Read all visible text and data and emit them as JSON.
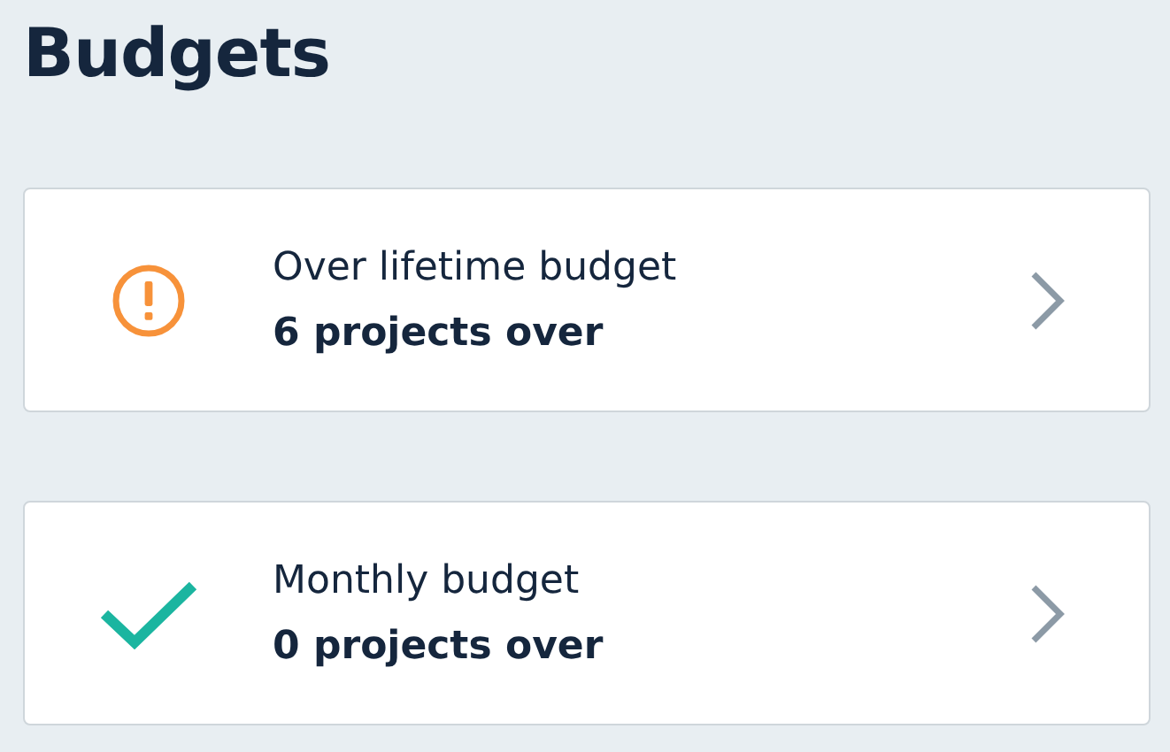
{
  "title": "Budgets",
  "cards": [
    {
      "kind": "warning",
      "label": "Over lifetime budget",
      "summary": "6 projects over"
    },
    {
      "kind": "ok",
      "label": "Monthly budget",
      "summary": "0 projects over"
    }
  ]
}
